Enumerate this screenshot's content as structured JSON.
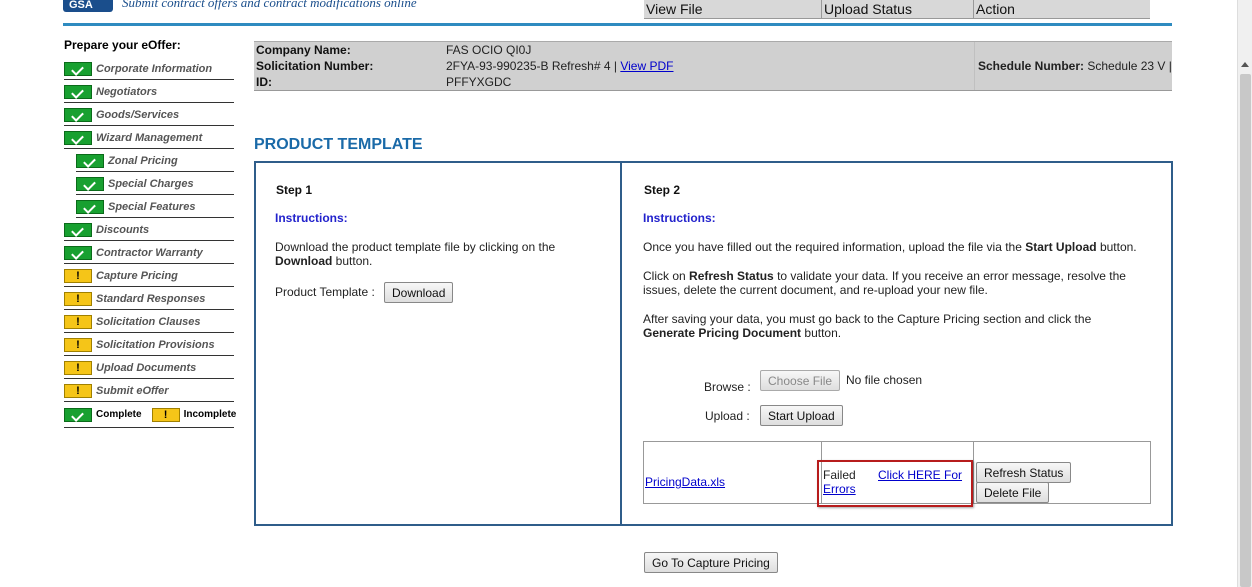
{
  "header": {
    "logo_text": "GSA",
    "tagline": "Submit contract offers and contract modifications online"
  },
  "sidebar": {
    "title": "Prepare your eOffer:",
    "items": [
      {
        "label": "Corporate Information",
        "status": "complete",
        "sub": false
      },
      {
        "label": "Negotiators",
        "status": "complete",
        "sub": false
      },
      {
        "label": "Goods/Services",
        "status": "complete",
        "sub": false
      },
      {
        "label": "Wizard Management",
        "status": "complete",
        "sub": false
      },
      {
        "label": "Zonal Pricing",
        "status": "complete",
        "sub": true
      },
      {
        "label": "Special Charges",
        "status": "complete",
        "sub": true
      },
      {
        "label": "Special Features",
        "status": "complete",
        "sub": true
      },
      {
        "label": "Discounts",
        "status": "complete",
        "sub": false
      },
      {
        "label": "Contractor Warranty",
        "status": "complete",
        "sub": false
      },
      {
        "label": "Capture Pricing",
        "status": "incomplete",
        "sub": false
      },
      {
        "label": "Standard Responses",
        "status": "incomplete",
        "sub": false
      },
      {
        "label": "Solicitation Clauses",
        "status": "incomplete",
        "sub": false
      },
      {
        "label": "Solicitation Provisions",
        "status": "incomplete",
        "sub": false
      },
      {
        "label": "Upload Documents",
        "status": "incomplete",
        "sub": false
      },
      {
        "label": "Submit eOffer",
        "status": "incomplete",
        "sub": false
      }
    ],
    "legend_complete": "Complete",
    "legend_incomplete": "Incomplete"
  },
  "info": {
    "company_label": "Company Name:",
    "company_value": "FAS OCIO QI0J",
    "solicitation_label": "Solicitation Number:",
    "solicitation_value": "2FYA-93-990235-B Refresh# 4 |",
    "view_pdf": "View PDF",
    "id_label": "ID:",
    "id_value": "PFFYXGDC",
    "schedule_label": "Schedule Number:",
    "schedule_value": "Schedule 23 V |"
  },
  "page_title": "PRODUCT TEMPLATE",
  "step1": {
    "title": "Step 1",
    "instructions": "Instructions:",
    "text_a": "Download the product template file by clicking on the",
    "text_b": "Download",
    "text_c": "button.",
    "template_label": "Product Template :",
    "download_button": "Download"
  },
  "step2": {
    "title": "Step 2",
    "instructions": "Instructions:",
    "p1_a": "Once you have filled out the required information, upload the file via the",
    "p1_b": "Start Upload",
    "p1_c": "button.",
    "p2_a": "Click on",
    "p2_b": "Refresh Status",
    "p2_c": "to validate your data. If you receive an error message, resolve the",
    "p2_d": "issues, delete the current document, and re-upload your new file.",
    "p3_a": "After saving your data, you must go back to the Capture Pricing section and click the",
    "p3_b": "Generate Pricing Document",
    "p3_c": "button.",
    "browse_label": "Browse :",
    "choose_file_button": "Choose File",
    "no_file": "No file chosen",
    "upload_label": "Upload :",
    "start_upload_button": "Start Upload"
  },
  "upload_table": {
    "headers": [
      "View File",
      "Upload Status",
      "Action"
    ],
    "row": {
      "file": "PricingData.xls",
      "status": "Failed",
      "errors_link_a": "Click HERE For",
      "errors_link_b": "Errors",
      "refresh_button": "Refresh Status",
      "delete_button": "Delete File"
    }
  },
  "capture_pricing_button": "Go To Capture Pricing"
}
